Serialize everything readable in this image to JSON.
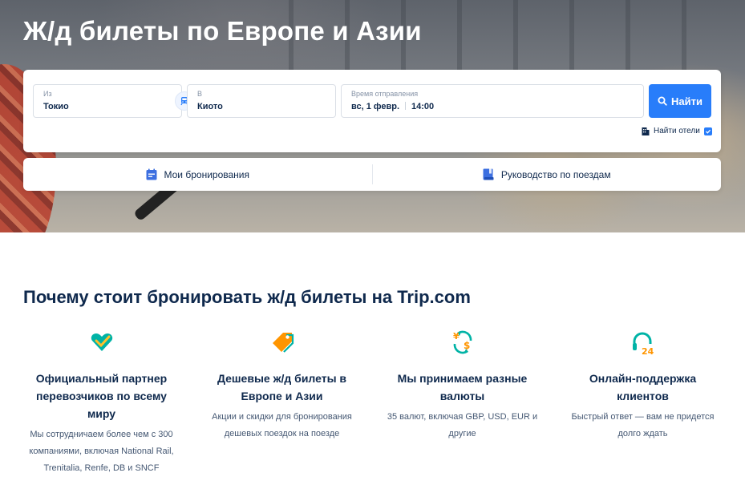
{
  "hero": {
    "title": "Ж/д билеты по Европе и Азии"
  },
  "search": {
    "from": {
      "label": "Из",
      "value": "Токио"
    },
    "to": {
      "label": "В",
      "value": "Киото"
    },
    "departure": {
      "label": "Время отправления",
      "date": "вс, 1 февр.",
      "time": "14:00"
    },
    "search_button": "Найти",
    "hotel_option": {
      "label": "Найти отели",
      "checked": true
    }
  },
  "quick_links": [
    {
      "label": "Мои бронирования",
      "icon": "calendar-icon"
    },
    {
      "label": "Руководство по поездам",
      "icon": "book-icon"
    }
  ],
  "why": {
    "title": "Почему стоит бронировать ж/д билеты на Trip.com",
    "features": [
      {
        "icon": "heart-check-icon",
        "title": "Официальный партнер перевозчиков по всему миру",
        "desc": "Мы сотрудничаем более чем с 300 компаниями, включая National Rail, Trenitalia, Renfe, DB и SNCF"
      },
      {
        "icon": "price-tag-icon",
        "title": "Дешевые ж/д билеты в Европе и Азии",
        "desc": "Акции и скидки для бронирования дешевых поездок на поезде"
      },
      {
        "icon": "currency-exchange-icon",
        "title": "Мы принимаем разные валюты",
        "desc": "35 валют, включая GBP, USD, EUR и другие"
      },
      {
        "icon": "support-24-icon",
        "title": "Онлайн-поддержка клиентов",
        "desc": "Быстрый ответ — вам не придется долго ждать"
      }
    ]
  },
  "colors": {
    "accent": "#287dfa",
    "text_dark": "#0f294d",
    "text_muted": "#455873",
    "teal": "#00b3a6",
    "orange": "#ff9500"
  }
}
